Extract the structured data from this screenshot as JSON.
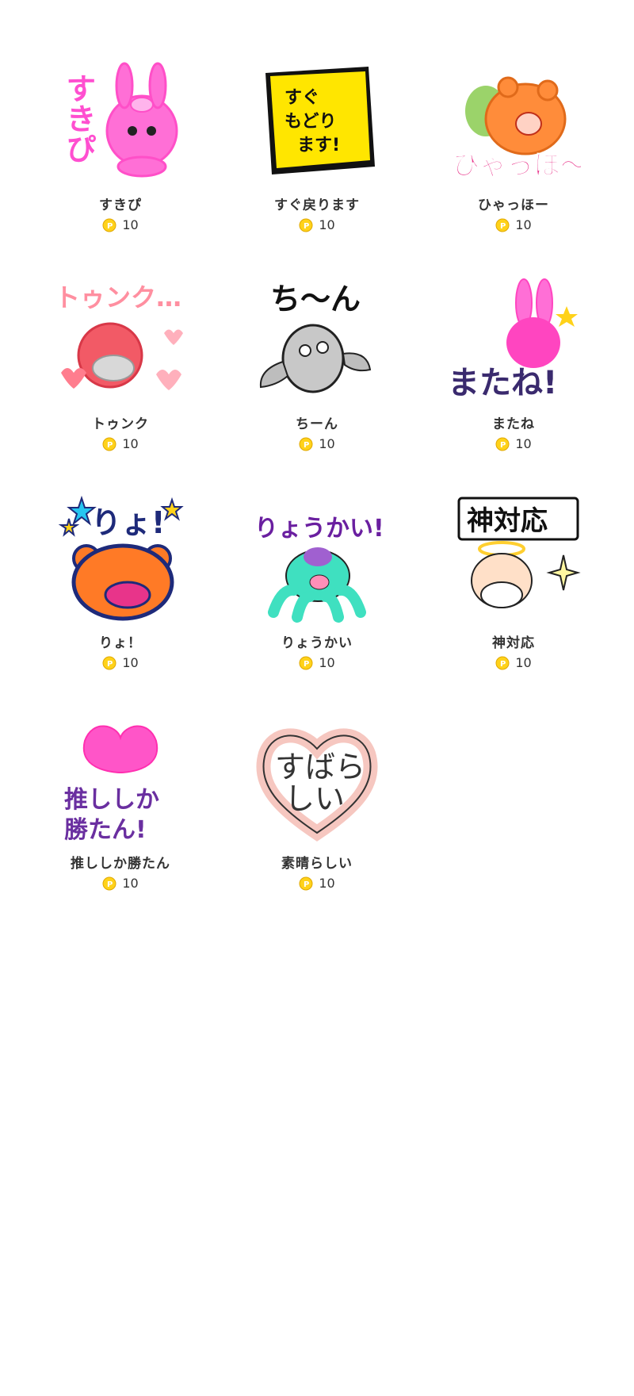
{
  "stickers": [
    {
      "name": "すきぴ",
      "price": "10",
      "art_text": "すきぴ",
      "icon": "pink-bunny-sticker",
      "colors": {
        "main": "#ff5fd2",
        "accent": "#ff4fc8"
      }
    },
    {
      "name": "すぐ戻ります",
      "price": "10",
      "art_text": "すぐ もどり ます!",
      "icon": "sticky-note-sticker",
      "colors": {
        "main": "#ffe600",
        "accent": "#111111"
      }
    },
    {
      "name": "ひゃっほー",
      "price": "10",
      "art_text": "ひゃっほ〜",
      "icon": "orange-bear-sticker",
      "colors": {
        "main": "#ff8c3a",
        "accent": "#e8348a"
      }
    },
    {
      "name": "トゥンク",
      "price": "10",
      "art_text": "トゥンク…",
      "icon": "heart-blob-sticker",
      "colors": {
        "main": "#f25a66",
        "accent": "#ff8fa0"
      }
    },
    {
      "name": "ちーん",
      "price": "10",
      "art_text": "ち〜ん",
      "icon": "grey-bird-sticker",
      "colors": {
        "main": "#bdbdbd",
        "accent": "#111111"
      }
    },
    {
      "name": "またね",
      "price": "10",
      "art_text": "またね!",
      "icon": "pink-rabbit-sticker",
      "colors": {
        "main": "#ff45c0",
        "accent": "#3a2a6e"
      }
    },
    {
      "name": "りょ！",
      "price": "10",
      "art_text": "りょ!",
      "icon": "bear-stars-sticker",
      "colors": {
        "main": "#ff7a26",
        "accent": "#1e2a7a"
      }
    },
    {
      "name": "りょうかい",
      "price": "10",
      "art_text": "りょうかい!",
      "icon": "octopus-sticker",
      "colors": {
        "main": "#3fe0c0",
        "accent": "#6a1fa0"
      }
    },
    {
      "name": "神対応",
      "price": "10",
      "art_text": "神対応",
      "icon": "angel-grandpa-sticker",
      "colors": {
        "main": "#ffe9a8",
        "accent": "#111111"
      }
    },
    {
      "name": "推ししか勝たん",
      "price": "10",
      "art_text": "推ししか 勝たん!",
      "icon": "pink-heart-sticker",
      "colors": {
        "main": "#ff55c8",
        "accent": "#6a2fa0"
      }
    },
    {
      "name": "素晴らしい",
      "price": "10",
      "art_text": "すばらしい",
      "icon": "ribbon-heart-sticker",
      "colors": {
        "main": "#f6c7c0",
        "accent": "#333333"
      }
    }
  ],
  "coin_icon": "coin-icon",
  "coin_color": "#ffd21a"
}
